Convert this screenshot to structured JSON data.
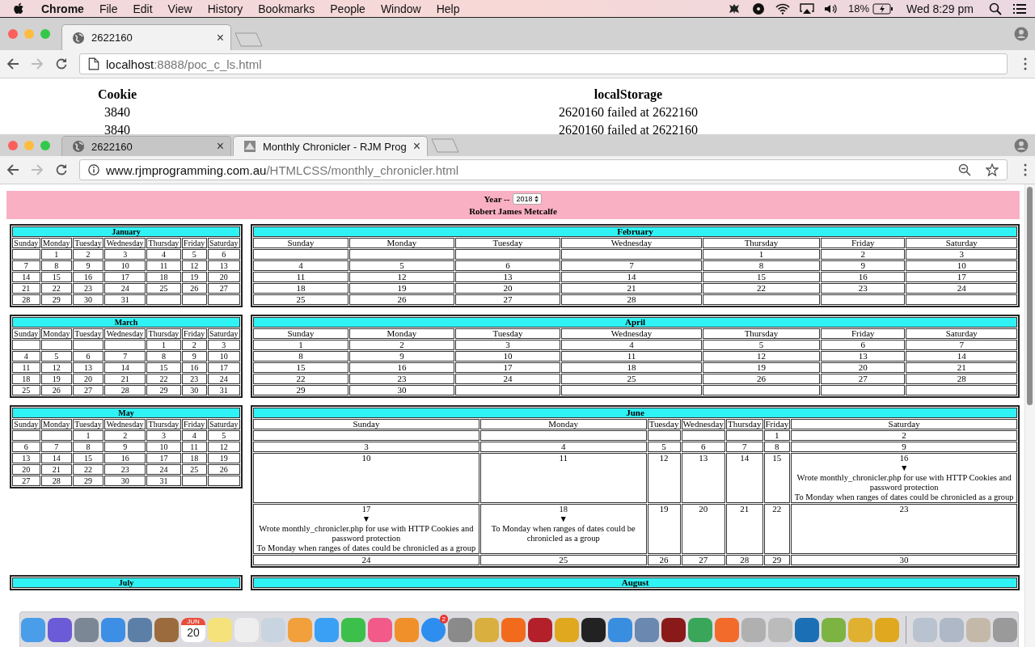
{
  "menubar": {
    "app": "Chrome",
    "items": [
      "File",
      "Edit",
      "View",
      "History",
      "Bookmarks",
      "People",
      "Window",
      "Help"
    ],
    "battery": "18%",
    "clock": "Wed 8:29 pm"
  },
  "window_1": {
    "tabs": [
      {
        "title": "2622160",
        "close": "×",
        "selected": true
      }
    ],
    "url_host": "localhost",
    "url_path": ":8888/poc_c_ls.html",
    "table": {
      "columns": [
        "Cookie",
        "localStorage"
      ],
      "rows": [
        [
          "3840",
          "2620160 failed at 2622160"
        ],
        [
          "3840",
          "2620160 failed at 2622160"
        ]
      ]
    }
  },
  "window_2": {
    "tabs": [
      {
        "title": "2622160",
        "close": "×",
        "selected": false
      },
      {
        "title": "Monthly Chronicler - RJM Prog",
        "close": "×",
        "selected": true
      }
    ],
    "url_host": "www.rjmprogramming.com.au",
    "url_path": "/HTMLCSS/monthly_chronicler.html",
    "header": {
      "year_label": "Year --",
      "year": "2018",
      "author": "Robert James Metcalfe"
    },
    "months": [
      {
        "name": "January",
        "weekdays": [
          "Sunday",
          "Monday",
          "Tuesday",
          "Wednesday",
          "Thursday",
          "Friday",
          "Saturday"
        ],
        "weeks": [
          [
            {
              "kind": "blank"
            },
            "1",
            "2",
            "3",
            "4",
            "5",
            "6"
          ],
          [
            "7",
            "8",
            "9",
            "10",
            "11",
            "12",
            "13"
          ],
          [
            "14",
            "15",
            "16",
            "17",
            "18",
            "19",
            "20"
          ],
          [
            "21",
            "22",
            "23",
            "24",
            "25",
            "26",
            "27"
          ],
          [
            "28",
            "29",
            "30",
            "31",
            {
              "kind": "blank"
            },
            {
              "kind": "blank"
            },
            {
              "kind": "blank"
            }
          ]
        ]
      },
      {
        "name": "February",
        "weekdays": [
          "Sunday",
          "Monday",
          "Tuesday",
          "Wednesday",
          "Thursday",
          "Friday",
          "Saturday"
        ],
        "weeks": [
          [
            {
              "kind": "blank"
            },
            {
              "kind": "blank"
            },
            {
              "kind": "blank"
            },
            {
              "kind": "blank"
            },
            "1",
            "2",
            "3"
          ],
          [
            "4",
            "5",
            "6",
            "7",
            "8",
            "9",
            "10"
          ],
          [
            "11",
            "12",
            "13",
            "14",
            "15",
            "16",
            "17"
          ],
          [
            "18",
            "19",
            "20",
            "21",
            "22",
            "23",
            "24"
          ],
          [
            "25",
            "26",
            "27",
            "28",
            {
              "kind": "blank"
            },
            {
              "kind": "blank"
            },
            {
              "kind": "blank"
            }
          ]
        ]
      },
      {
        "name": "March",
        "weekdays": [
          "Sunday",
          "Monday",
          "Tuesday",
          "Wednesday",
          "Thursday",
          "Friday",
          "Saturday"
        ],
        "weeks": [
          [
            {
              "kind": "blank"
            },
            {
              "kind": "blank"
            },
            {
              "kind": "blank"
            },
            {
              "kind": "blank"
            },
            "1",
            "2",
            "3"
          ],
          [
            "4",
            "5",
            "6",
            "7",
            "8",
            "9",
            "10"
          ],
          [
            "11",
            "12",
            "13",
            "14",
            "15",
            "16",
            "17"
          ],
          [
            "18",
            "19",
            "20",
            "21",
            "22",
            "23",
            "24"
          ],
          [
            "25",
            "26",
            "27",
            "28",
            "29",
            "30",
            "31"
          ]
        ]
      },
      {
        "name": "April",
        "weekdays": [
          "Sunday",
          "Monday",
          "Tuesday",
          "Wednesday",
          "Thursday",
          "Friday",
          "Saturday"
        ],
        "weeks": [
          [
            "1",
            "2",
            "3",
            "4",
            "5",
            "6",
            "7"
          ],
          [
            "8",
            "9",
            "10",
            "11",
            "12",
            "13",
            "14"
          ],
          [
            "15",
            "16",
            "17",
            "18",
            "19",
            "20",
            "21"
          ],
          [
            "22",
            "23",
            "24",
            "25",
            "26",
            "27",
            "28"
          ],
          [
            "29",
            "30",
            {
              "kind": "blank"
            },
            {
              "kind": "blank"
            },
            {
              "kind": "blank"
            },
            {
              "kind": "blank"
            },
            {
              "kind": "blank"
            }
          ]
        ]
      },
      {
        "name": "May",
        "weekdays": [
          "Sunday",
          "Monday",
          "Tuesday",
          "Wednesday",
          "Thursday",
          "Friday",
          "Saturday"
        ],
        "weeks": [
          [
            {
              "kind": "blank"
            },
            {
              "kind": "blank"
            },
            "1",
            "2",
            "3",
            "4",
            "5"
          ],
          [
            "6",
            "7",
            "8",
            "9",
            "10",
            "11",
            "12"
          ],
          [
            "13",
            "14",
            "15",
            "16",
            "17",
            "18",
            "19"
          ],
          [
            "20",
            "21",
            "22",
            "23",
            "24",
            "25",
            "26"
          ],
          [
            "27",
            "28",
            "29",
            "30",
            "31",
            {
              "kind": "blank"
            },
            {
              "kind": "blank"
            }
          ]
        ]
      },
      {
        "name": "June",
        "weekdays": [
          "Sunday",
          "Monday",
          "Tuesday",
          "Wednesday",
          "Thursday",
          "Friday",
          "Saturday"
        ],
        "weeks": [
          [
            {
              "kind": "blank"
            },
            {
              "kind": "blank"
            },
            {
              "kind": "blank"
            },
            {
              "kind": "blank"
            },
            {
              "kind": "blank"
            },
            "1",
            "2"
          ],
          [
            "3",
            "4",
            "5",
            "6",
            "7",
            "8",
            "9"
          ],
          [
            "10",
            "11",
            "12",
            "13",
            "14",
            "15",
            {
              "kind": "event",
              "day": "16",
              "marker": "▼",
              "notes": [
                "Wrote monthly_chronicler.php for use with HTTP Cookies and password protection",
                "To Monday when ranges of dates could be chronicled as a group"
              ]
            }
          ],
          [
            {
              "kind": "event",
              "day": "17",
              "marker": "▼",
              "notes": [
                "Wrote monthly_chronicler.php for use with HTTP Cookies and password protection",
                "To Monday when ranges of dates could be chronicled as a group"
              ]
            },
            {
              "kind": "event",
              "day": "18",
              "marker": "▼",
              "notes": [
                "To Monday when ranges of dates could be chronicled as a group"
              ]
            },
            "19",
            "20",
            "21",
            "22",
            "23"
          ],
          [
            "24",
            "25",
            "26",
            "27",
            "28",
            "29",
            "30"
          ]
        ]
      },
      {
        "name": "July"
      },
      {
        "name": "August"
      }
    ]
  },
  "dock": {
    "calendar_month": "JUN",
    "calendar_day": "20",
    "badge": "2"
  }
}
